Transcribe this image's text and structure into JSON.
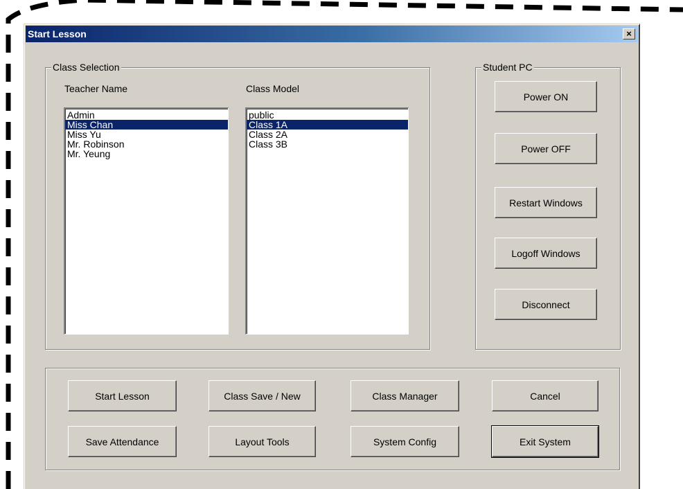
{
  "window": {
    "title": "Start Lesson",
    "close_label": "×"
  },
  "class_selection": {
    "group_label": "Class Selection",
    "teacher_label": "Teacher Name",
    "model_label": "Class Model",
    "teachers": [
      "Admin",
      "Miss Chan",
      "Miss Yu",
      "Mr. Robinson",
      "Mr. Yeung"
    ],
    "teachers_selected": "Miss Chan",
    "models": [
      "public",
      "Class 1A",
      "Class 2A",
      "Class 3B"
    ],
    "models_selected": "Class 1A"
  },
  "student_pc": {
    "group_label": "Student PC",
    "buttons": [
      "Power ON",
      "Power OFF",
      "Restart Windows",
      "Logoff Windows",
      "Disconnect"
    ]
  },
  "actions": {
    "row1": [
      "Start Lesson",
      "Class Save / New",
      "Class Manager",
      "Cancel"
    ],
    "row2": [
      "Save Attendance",
      "Layout Tools",
      "System Config",
      "Exit System"
    ]
  },
  "colors": {
    "dialog_face": "#d4d0c8",
    "title_gradient_start": "#0a246a",
    "selection": "#0a246a"
  }
}
